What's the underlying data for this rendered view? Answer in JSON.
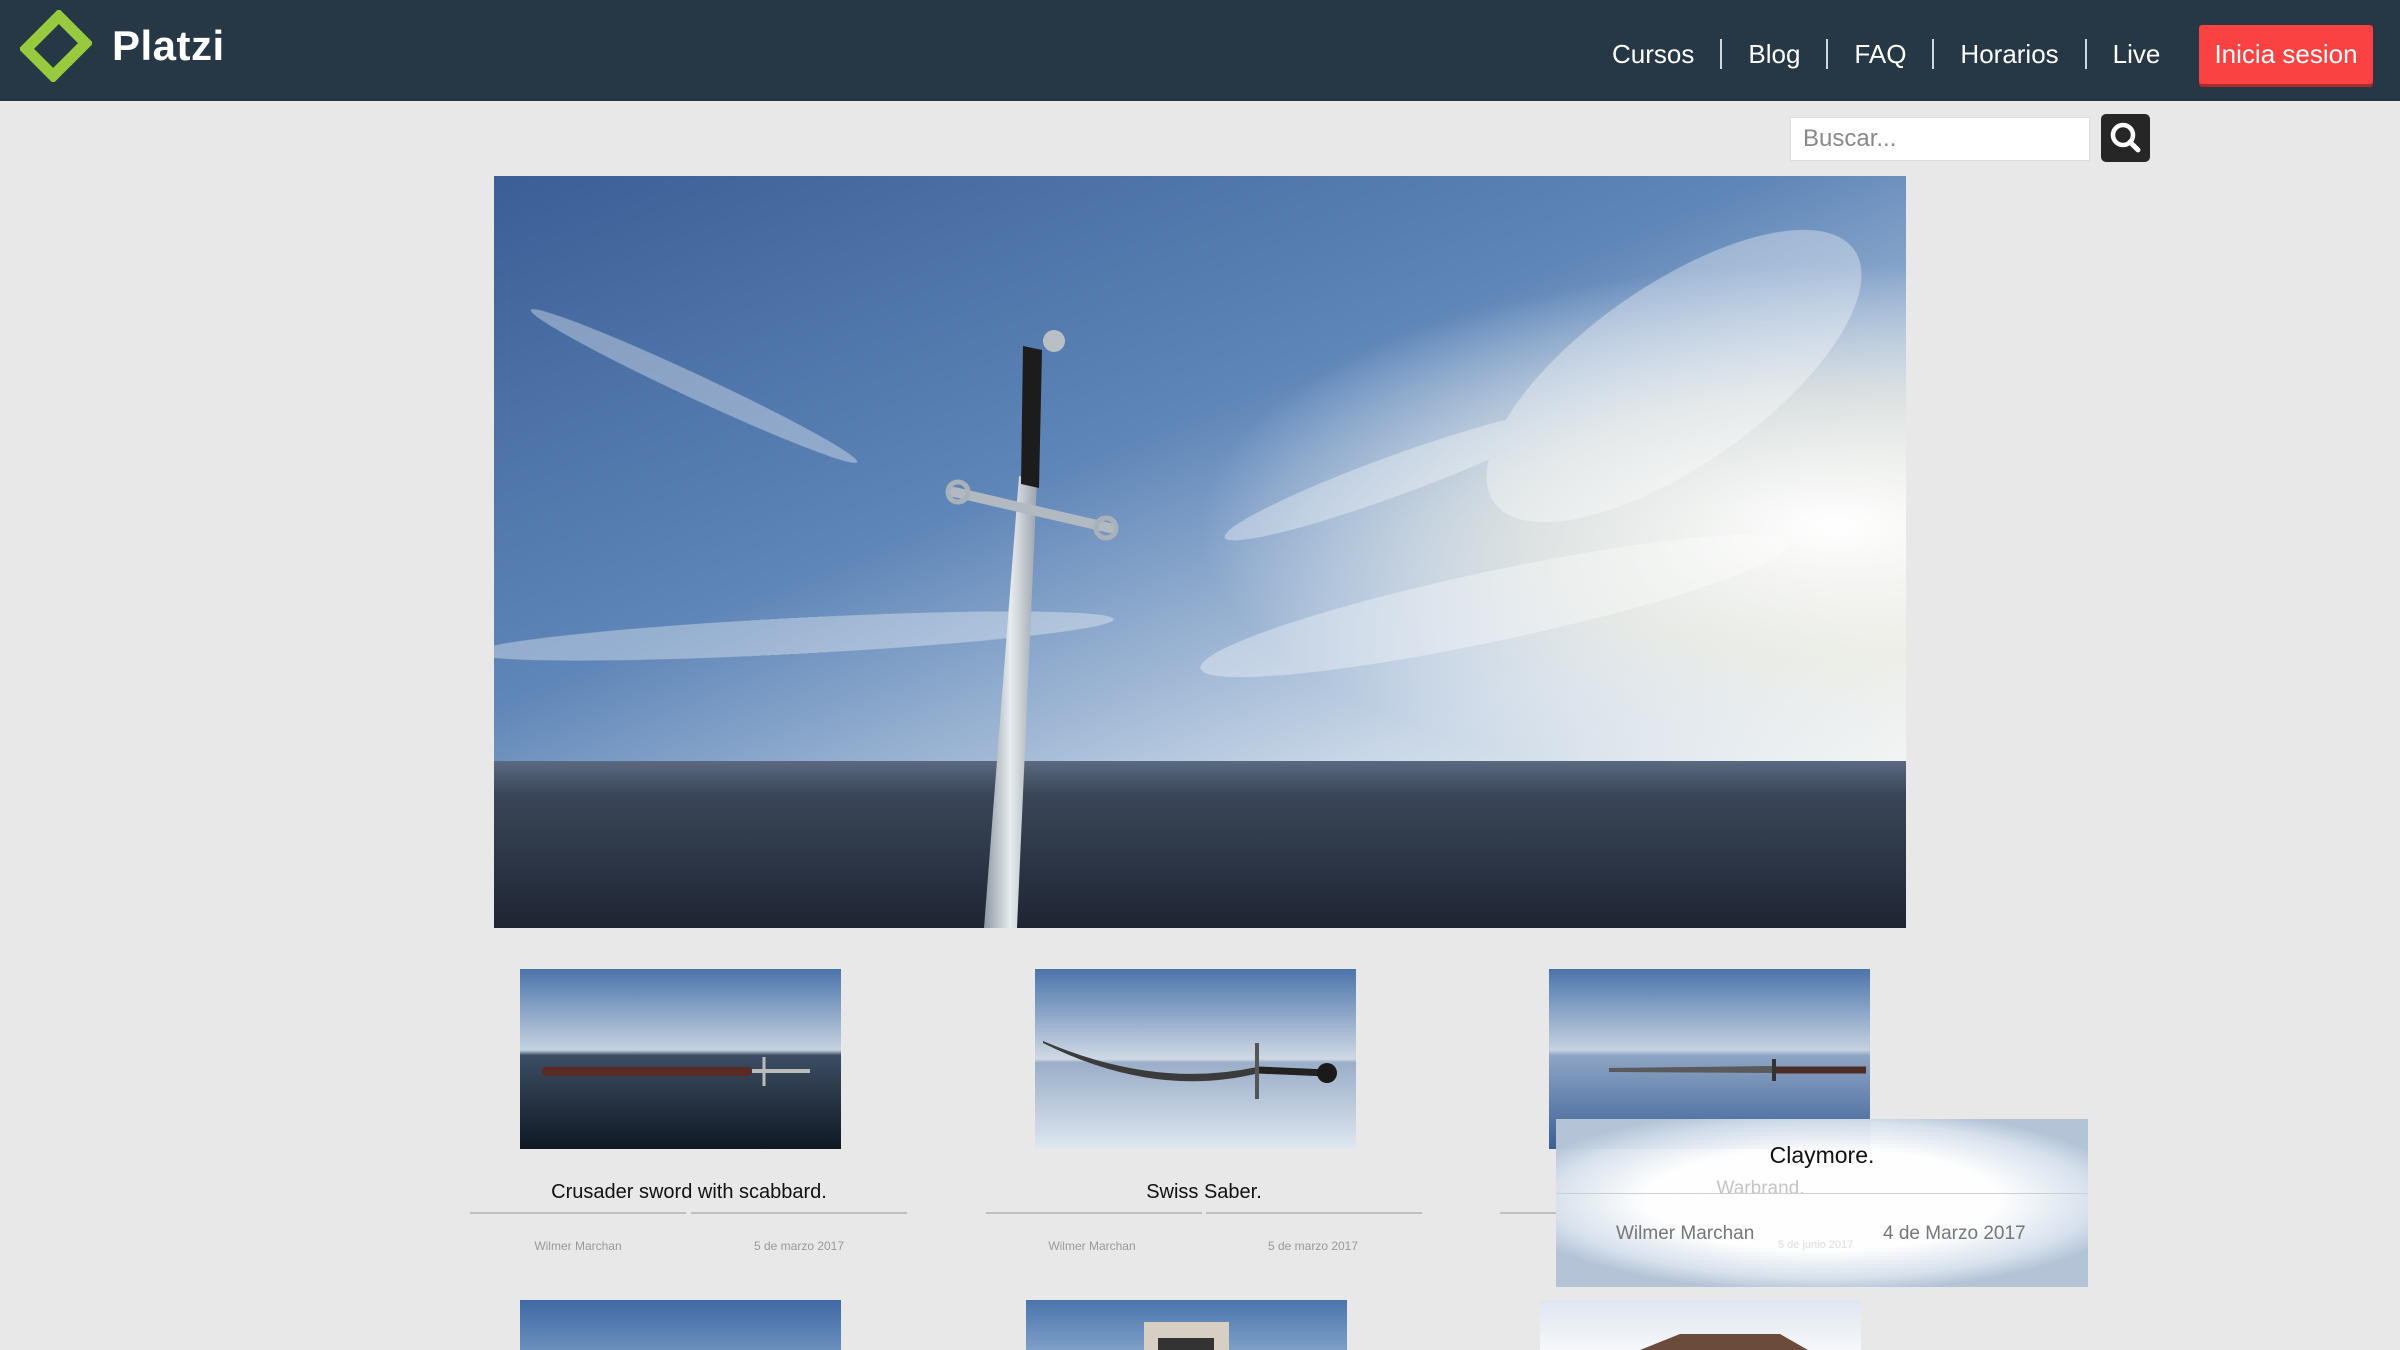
{
  "header": {
    "brand": "Platzi",
    "nav": [
      "Cursos",
      "Blog",
      "FAQ",
      "Horarios",
      "Live"
    ],
    "login_label": "Inicia sesion"
  },
  "search": {
    "placeholder": "Buscar..."
  },
  "cards": [
    {
      "title": "Crusader sword with scabbard.",
      "author": "Wilmer Marchan",
      "date": "5 de marzo 2017"
    },
    {
      "title": "Swiss Saber.",
      "author": "Wilmer Marchan",
      "date": "5 de marzo 2017"
    },
    {
      "title": "Warbrand.",
      "author": "Wilmer Marchan",
      "date": "5 de junio 2017"
    }
  ],
  "popover": {
    "title": "Claymore.",
    "author": "Wilmer Marchan",
    "date": "4 de Marzo 2017"
  },
  "colors": {
    "header_bg": "#263745",
    "accent": "#fa4242",
    "logo_green": "#98ca3f",
    "page_bg": "#e8e8e8"
  },
  "icons": [
    "platzi-logo-icon",
    "search-icon"
  ]
}
